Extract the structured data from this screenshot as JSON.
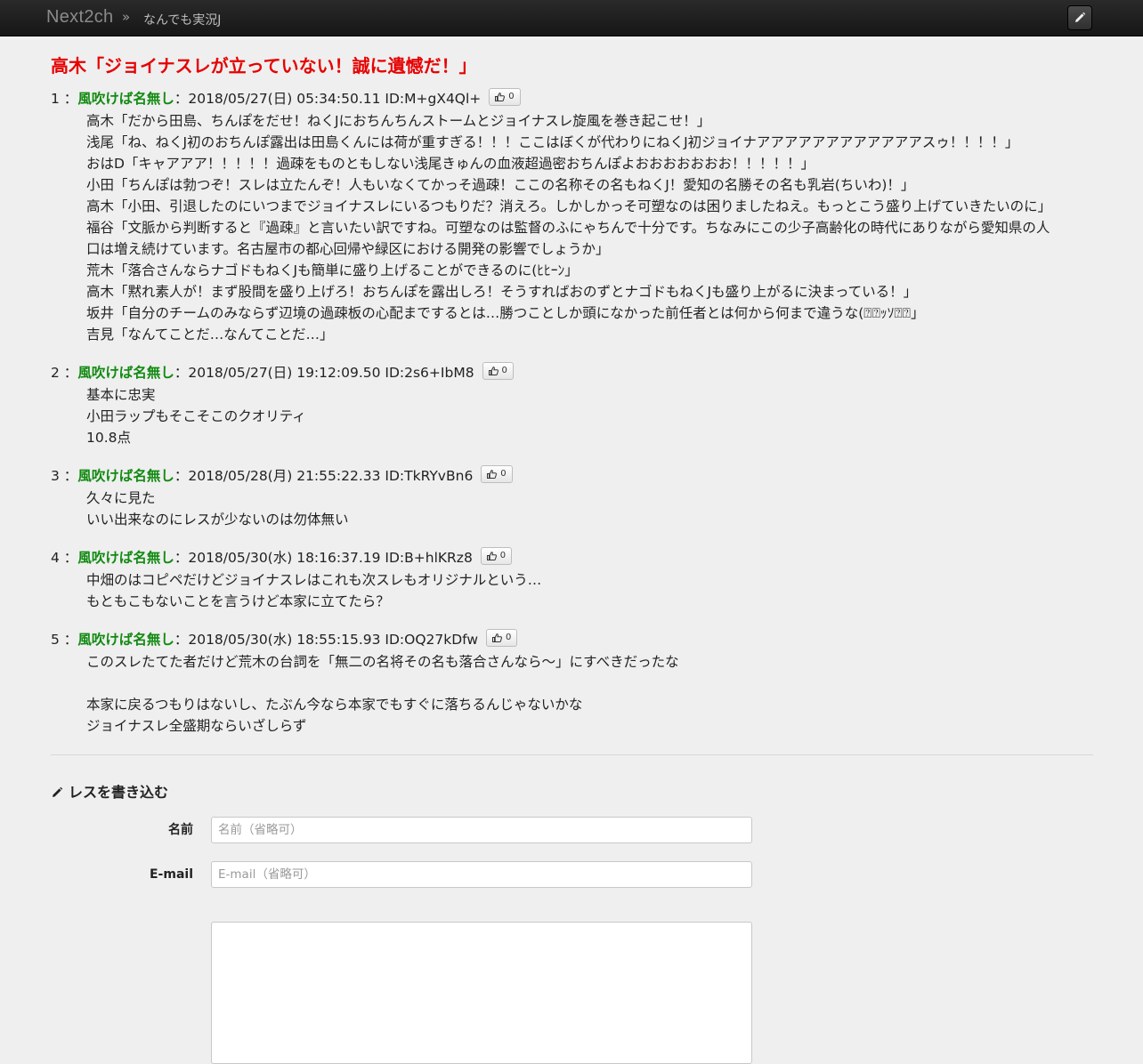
{
  "navbar": {
    "brand": "Next2ch",
    "separator": "»",
    "board": "なんでも実況J"
  },
  "thread": {
    "title": "高木「ジョイナスレが立っていない！誠に遺憾だ！」"
  },
  "posts": [
    {
      "num": "1",
      "name": "風吹けば名無し",
      "meta": "2018/05/27(日) 05:34:50.11 ID:M+gX4Ql+",
      "likes": "0",
      "lines": [
        "高木「だから田島、ちんぽをだせ！ねくJにおちんちんストームとジョイナスレ旋風を巻き起こせ！」",
        "浅尾「ね、ねくJ初のおちんぽ露出は田島くんには荷が重すぎる！！！ここはぼくが代わりにねくJ初ジョイナアアアアアアアアアアアアスゥ！！！！」",
        "おはD「キャアアア！！！！！過疎をものともしない浅尾きゅんの血液超過密おちんぽよおおおおおおお！！！！！」",
        "小田「ちんぽは勃つぞ！スレは立たんぞ！人もいなくてかっそ過疎！ここの名称その名もねくJ！愛知の名勝その名も乳岩(ちいわ)！」",
        "高木「小田、引退したのにいつまでジョイナスレにいるつもりだ？消えろ。しかしかっそ可塑なのは困りましたねえ。もっとこう盛り上げていきたいのに」",
        "福谷「文脈から判断すると『過疎』と言いたい訳ですね。可塑なのは監督のふにゃちんで十分です。ちなみにこの少子高齢化の時代にありながら愛知県の人",
        "口は増え続けています。名古屋市の都心回帰や緑区における開発の影響でしょうか」",
        "荒木「落合さんならナゴドもねくJも簡単に盛り上げることができるのに(ﾋﾋｰﾝ」",
        "高木「黙れ素人が！まず股間を盛り上げろ！おちんぽを露出しろ！そうすればおのずとナゴドもねくJも盛り上がるに決まっている！」",
        "坂井「自分のチームのみならず辺境の過疎板の心配までするとは…勝つことしか頭になかった前任者とは何から何まで違うな(⍰⍰ｯｿ⍰⍰」",
        "吉見「なんてことだ…なんてことだ…」"
      ]
    },
    {
      "num": "2",
      "name": "風吹けば名無し",
      "meta": "2018/05/27(日) 19:12:09.50 ID:2s6+IbM8",
      "likes": "0",
      "lines": [
        "基本に忠実",
        "小田ラップもそこそこのクオリティ",
        "10.8点"
      ]
    },
    {
      "num": "3",
      "name": "風吹けば名無し",
      "meta": "2018/05/28(月) 21:55:22.33 ID:TkRYvBn6",
      "likes": "0",
      "lines": [
        "久々に見た",
        "いい出来なのにレスが少ないのは勿体無い"
      ]
    },
    {
      "num": "4",
      "name": "風吹けば名無し",
      "meta": "2018/05/30(水) 18:16:37.19 ID:B+hlKRz8",
      "likes": "0",
      "lines": [
        "中畑のはコピペだけどジョイナスレはこれも次スレもオリジナルという…",
        "もともこもないことを言うけど本家に立てたら？"
      ]
    },
    {
      "num": "5",
      "name": "風吹けば名無し",
      "meta": "2018/05/30(水) 18:55:15.93 ID:OQ27kDfw",
      "likes": "0",
      "lines": [
        "このスレたてた者だけど荒木の台詞を「無二の名将その名も落合さんなら〜」にすべきだったな",
        "",
        "本家に戻るつもりはないし、たぶん今なら本家でもすぐに落ちるんじゃないかな",
        "ジョイナスレ全盛期ならいざしらず"
      ]
    }
  ],
  "form": {
    "title": "レスを書き込む",
    "name_label": "名前",
    "name_placeholder": "名前（省略可）",
    "email_label": "E-mail",
    "email_placeholder": "E-mail（省略可）"
  }
}
